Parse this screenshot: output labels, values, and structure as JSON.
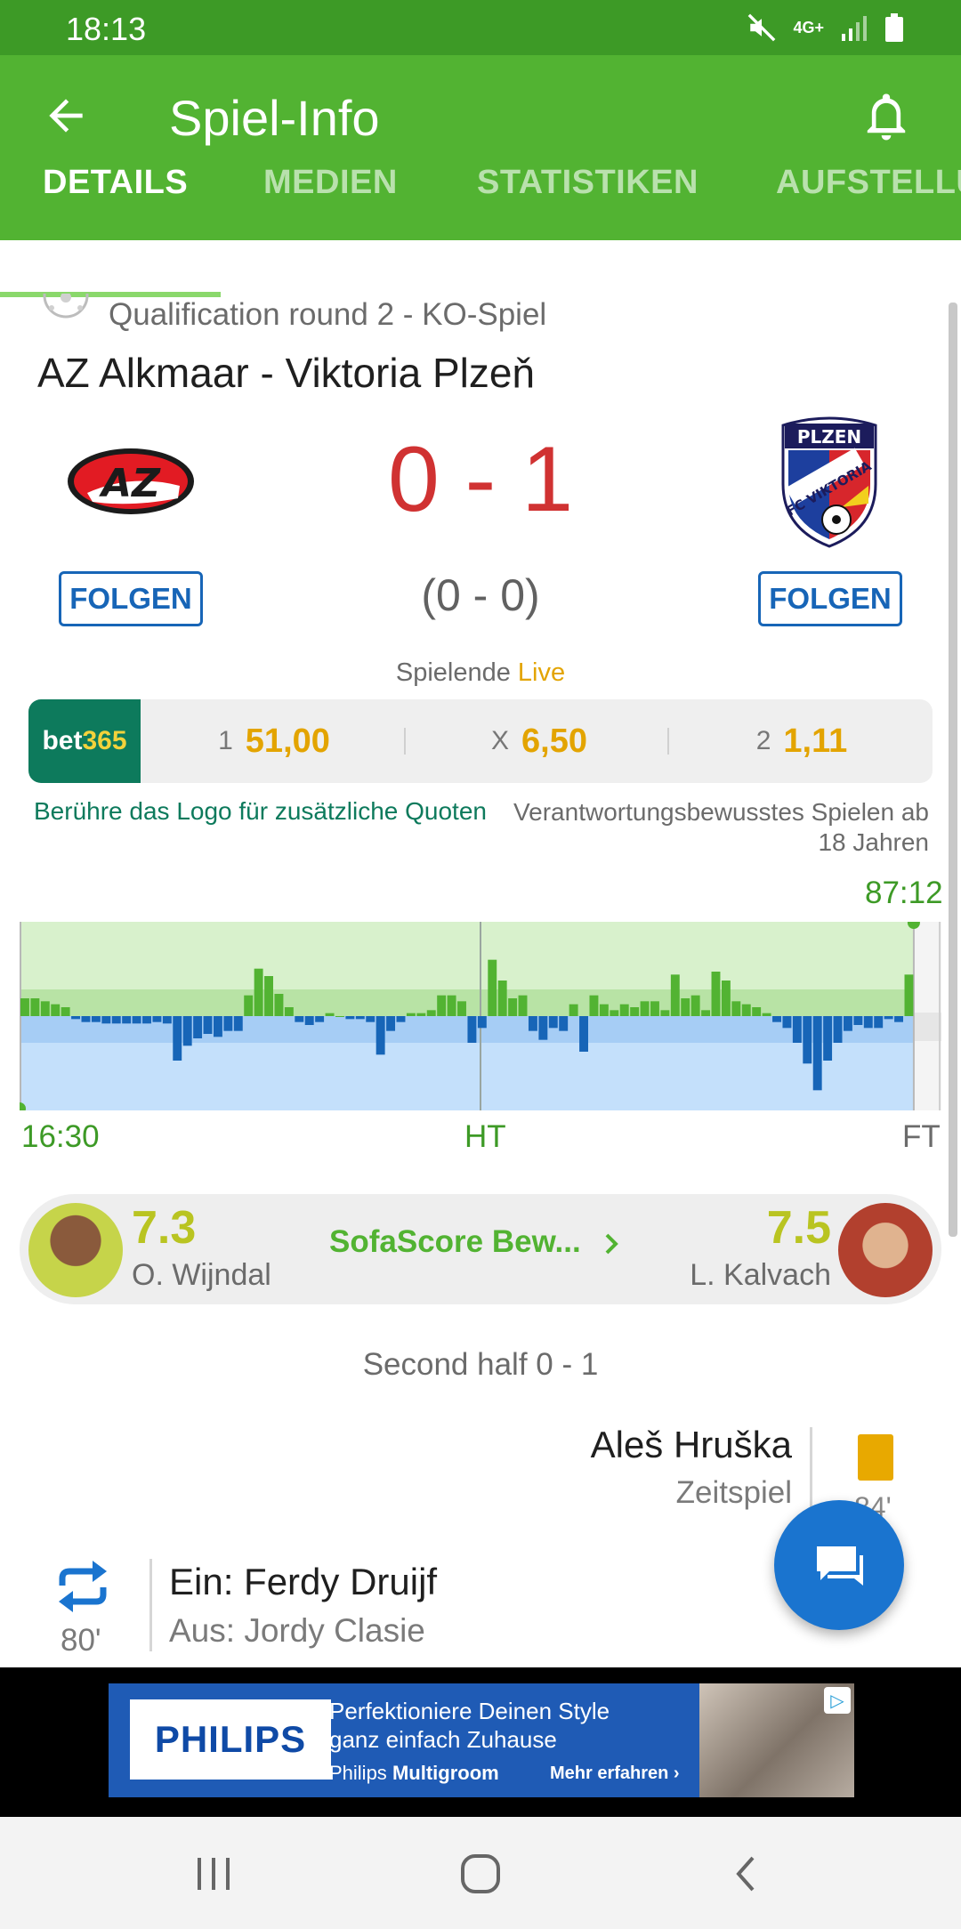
{
  "status_bar": {
    "time": "18:13",
    "network": "4G+"
  },
  "app_bar": {
    "title": "Spiel-Info"
  },
  "tabs": [
    "DETAILS",
    "MEDIEN",
    "STATISTIKEN",
    "AUFSTELLU"
  ],
  "match": {
    "round": "Qualification round 2 - KO-Spiel",
    "title": "AZ Alkmaar - Viktoria Plzeň",
    "home_logo": "AZ",
    "away_logo_top": "PLZEN",
    "away_logo_middle": "FC VIKTORIA",
    "score": "0 - 1",
    "halftime": "(0 - 0)",
    "follow_label": "FOLGEN",
    "status_prefix": "Spielende",
    "status_live": "Live"
  },
  "odds": {
    "provider_a": "bet",
    "provider_b": "365",
    "items": [
      {
        "label": "1",
        "value": "51,00"
      },
      {
        "label": "X",
        "value": "6,50"
      },
      {
        "label": "2",
        "value": "1,11"
      }
    ],
    "note_left": "Berühre das Logo für zusätzliche Quoten",
    "note_right": "Verantwortungsbewusstes Spielen ab 18 Jahren"
  },
  "momentum": {
    "current_time": "87:12",
    "start_label": "16:30",
    "half_label": "HT",
    "end_label": "FT",
    "progress": 0.97,
    "values": [
      12,
      12,
      10,
      8,
      6,
      -2,
      -4,
      -4,
      -5,
      -5,
      -5,
      -5,
      -5,
      -4,
      -5,
      -30,
      -20,
      -15,
      -12,
      -14,
      -10,
      -10,
      14,
      32,
      27,
      15,
      6,
      -4,
      -6,
      -4,
      2,
      0,
      -2,
      -2,
      -4,
      -26,
      -10,
      -4,
      2,
      2,
      4,
      14,
      14,
      10,
      -18,
      -8,
      38,
      24,
      12,
      14,
      -10,
      -16,
      -8,
      -10,
      8,
      -24,
      14,
      8,
      4,
      8,
      6,
      10,
      10,
      4,
      28,
      12,
      14,
      4,
      30,
      24,
      10,
      8,
      6,
      2,
      -4,
      -8,
      -18,
      -32,
      -50,
      -30,
      -18,
      -10,
      -6,
      -8,
      -8,
      -2,
      -4,
      28
    ]
  },
  "ratings": {
    "home_score": "7.3",
    "home_player": "O. Wijndal",
    "center_label": "SofaScore Bew...",
    "away_score": "7.5",
    "away_player": "L. Kalvach"
  },
  "timeline": {
    "period_label": "Second half 0 - 1",
    "events": [
      {
        "player": "Aleš Hruška",
        "detail": "Zeitspiel",
        "minute": "84'"
      },
      {
        "player_in": "Ein: Ferdy Druijf",
        "player_out": "Aus: Jordy Clasie",
        "minute": "80'"
      }
    ]
  },
  "ad": {
    "brand": "PHILIPS",
    "line1": "Perfektioniere Deinen Style",
    "line2": "ganz einfach Zuhause",
    "line3_bold": "Philips",
    "line3": "Multigroom",
    "cta": "Mehr erfahren ›"
  },
  "colors": {
    "primary": "#52b332",
    "status_bar": "#3d9a26",
    "score": "#d03232",
    "accent_yellow": "#e3a400",
    "follow_blue": "#1765b7",
    "fab_blue": "#1a74cf",
    "bet365_green": "#0d7a5c"
  },
  "icons": [
    "back-arrow-icon",
    "bell-icon",
    "substitution-icon",
    "yellow-card-icon",
    "chat-icon",
    "mute-icon",
    "signal-icon",
    "battery-icon"
  ]
}
